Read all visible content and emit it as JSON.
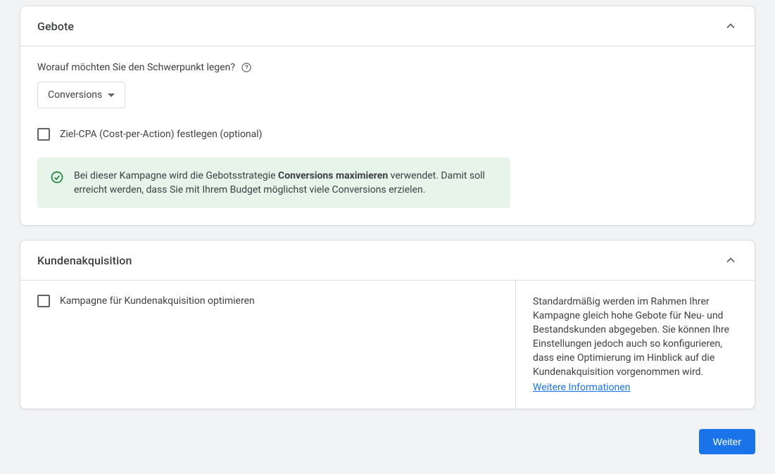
{
  "bidding": {
    "title": "Gebote",
    "focus_label": "Worauf möchten Sie den Schwerpunkt legen?",
    "focus_value": "Conversions",
    "target_cpa_label": "Ziel-CPA (Cost-per-Action) festlegen (optional)",
    "info_prefix": "Bei dieser Kampagne wird die Gebotsstrategie ",
    "info_strategy": "Conversions maximieren",
    "info_suffix": " verwendet. Damit soll erreicht werden, dass Sie mit Ihrem Budget möglichst viele Conversions erzielen."
  },
  "acquisition": {
    "title": "Kundenakquisition",
    "optimize_label": "Kampagne für Kundenakquisition optimieren",
    "help_text": "Standardmäßig werden im Rahmen Ihrer Kampagne gleich hohe Gebote für Neu- und Bestandskunden abgegeben. Sie können Ihre Einstellungen jedoch auch so konfigurieren, dass eine Optimierung im Hinblick auf die Kundenakquisition vorgenommen wird.",
    "learn_more": "Weitere Informationen"
  },
  "footer": {
    "next": "Weiter"
  }
}
